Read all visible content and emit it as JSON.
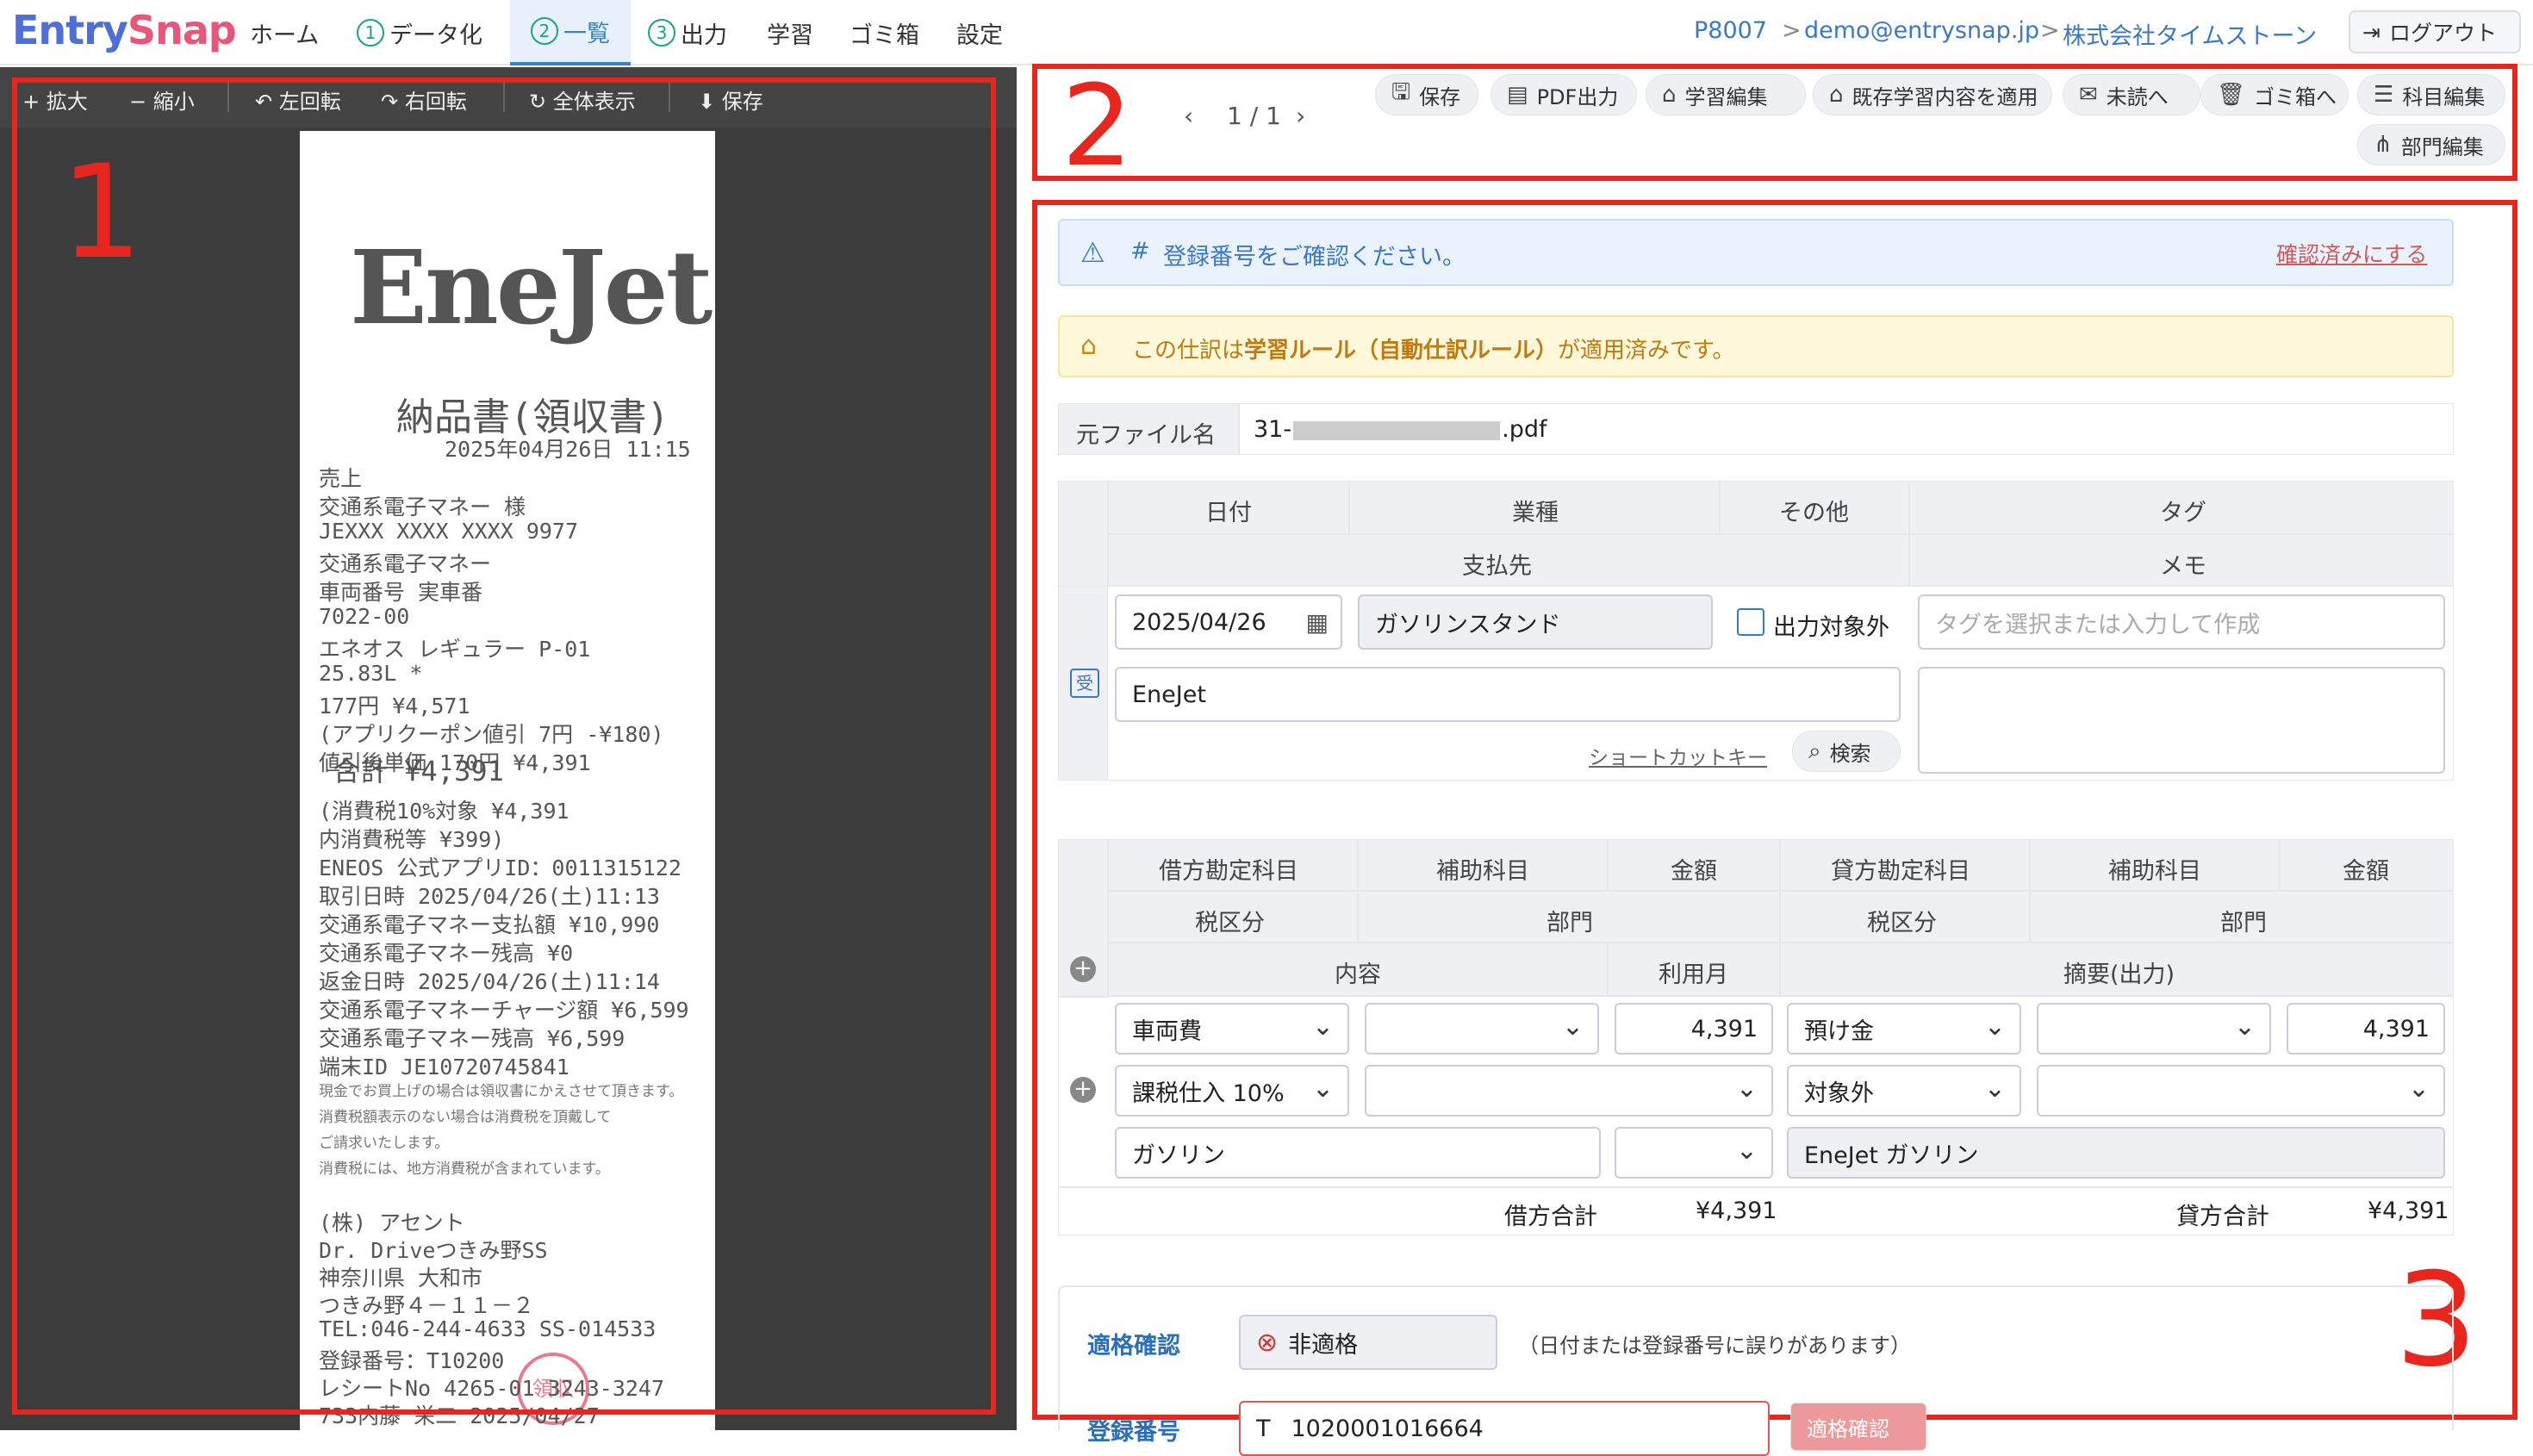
{
  "app": {
    "logo_a": "Entry",
    "logo_b": "Snap"
  },
  "nav": {
    "home": "ホーム",
    "step1_num": "1",
    "step1": "データ化",
    "step2_num": "2",
    "step2": "一覧",
    "step3_num": "3",
    "step3": "出力",
    "learn": "学習",
    "trash": "ゴミ箱",
    "settings": "設定"
  },
  "breadcrumb": {
    "code": "P8007",
    "email": "demo@entrysnap.jp",
    "company": "株式会社タイムストーン",
    "sep": ">"
  },
  "logout": "ログアウト",
  "viewer": {
    "zoom_in": "拡大",
    "zoom_out": "縮小",
    "rotate_left": "左回転",
    "rotate_right": "右回転",
    "fit": "全体表示",
    "save": "保存"
  },
  "receipt": {
    "logo": "EneJet",
    "title": "納品書(領収書)",
    "datetime": "2025年04月26日 11:15",
    "lines": [
      "売上",
      "交通系電子マネー        様",
      "JEXXX XXXX XXXX 9977",
      "交通系電子マネー",
      "車両番号        実車番",
      "7022-00",
      "エネオス  レギュラー   P-01",
      "    25.83L            *",
      "              177円     ¥4,571",
      "(アプリクーポン値引  7円    -¥180)",
      "値引後単価  170円       ¥4,391"
    ],
    "total": "合計       ¥4,391",
    "lines2": [
      "(消費税10%対象        ¥4,391",
      "  内消費税等            ¥399)",
      "ENEOS 公式アプリID：0011315122",
      "取引日時     2025/04/26(土)11:13",
      "交通系電子マネー支払額    ¥10,990",
      "交通系電子マネー残高          ¥0",
      "返金日時     2025/04/26(土)11:14",
      "交通系電子マネーチャージ額  ¥6,599",
      "交通系電子マネー残高        ¥6,599",
      "端末ID              JE10720745841"
    ],
    "notes": [
      "現金でお買上げの場合は領収書にかえさせて頂きます。",
      "消費税額表示のない場合は消費税を頂戴して",
      "ご請求いたします。",
      "消費税には、地方消費税が含まれています。"
    ],
    "lines3": [
      "(株) アセント",
      "Dr. Driveつきみ野SS",
      "神奈川県 大和市",
      "つきみ野４－１１－２",
      "TEL:046-244-4633       SS-014533",
      "登録番号：T10200",
      "レシートNo 4265-01     3243-3247",
      "733内藤 栄二          2025/04/27"
    ],
    "stamp": "領収"
  },
  "annotations": [
    "1",
    "2",
    "3"
  ],
  "toolbar": {
    "save": "保存",
    "pdf": "PDF出力",
    "learn_edit": "学習編集",
    "apply_learn": "既存学習内容を適用",
    "unread": "未読へ",
    "trash": "ゴミ箱へ",
    "account_edit": "科目編集",
    "dept_edit": "部門編集"
  },
  "pager": {
    "page": "1 / 1"
  },
  "alert": {
    "text": "登録番号をご確認ください。",
    "action": "確認済みにする",
    "hash": "#"
  },
  "warn": {
    "pre": "この仕訳は",
    "rule": "学習ルール（自動仕訳ルール）",
    "post": "が適用済みです。"
  },
  "file": {
    "label": "元ファイル名",
    "name_pre": "31-",
    "name_post": ".pdf"
  },
  "header1": {
    "date": "日付",
    "industry": "業種",
    "other": "その他",
    "tag": "タグ",
    "payee": "支払先",
    "memo": "メモ"
  },
  "entry": {
    "badge": "受",
    "date": "2025/04/26",
    "industry": "ガソリンスタンド",
    "exclude": "出力対象外",
    "tag_placeholder": "タグを選択または入力して作成",
    "payee": "EneJet",
    "shortcut": "ショートカットキー",
    "search": "検索"
  },
  "header2": {
    "debit": "借方勘定科目",
    "sub": "補助科目",
    "amount": "金額",
    "credit": "貸方勘定科目",
    "sub2": "補助科目",
    "amount2": "金額",
    "tax": "税区分",
    "dept": "部門",
    "tax2": "税区分",
    "dept2": "部門",
    "content": "内容",
    "month": "利用月",
    "summary": "摘要(出力)"
  },
  "journal": {
    "debit": "車両費",
    "debit_amount": "4,391",
    "credit": "預け金",
    "credit_amount": "4,391",
    "tax": "課税仕入 10%",
    "tax2": "対象外",
    "content": "ガソリン",
    "summary": "EneJet ガソリン",
    "debit_total_label": "借方合計",
    "debit_total": "¥4,391",
    "credit_total_label": "貸方合計",
    "credit_total": "¥4,391"
  },
  "qualify": {
    "label": "適格確認",
    "status": "非適格",
    "note": "（日付または登録番号に誤りがあります）",
    "reg_label": "登録番号",
    "reg_prefix": "T",
    "reg_value": "1020001016664",
    "check_btn": "適格確認"
  }
}
